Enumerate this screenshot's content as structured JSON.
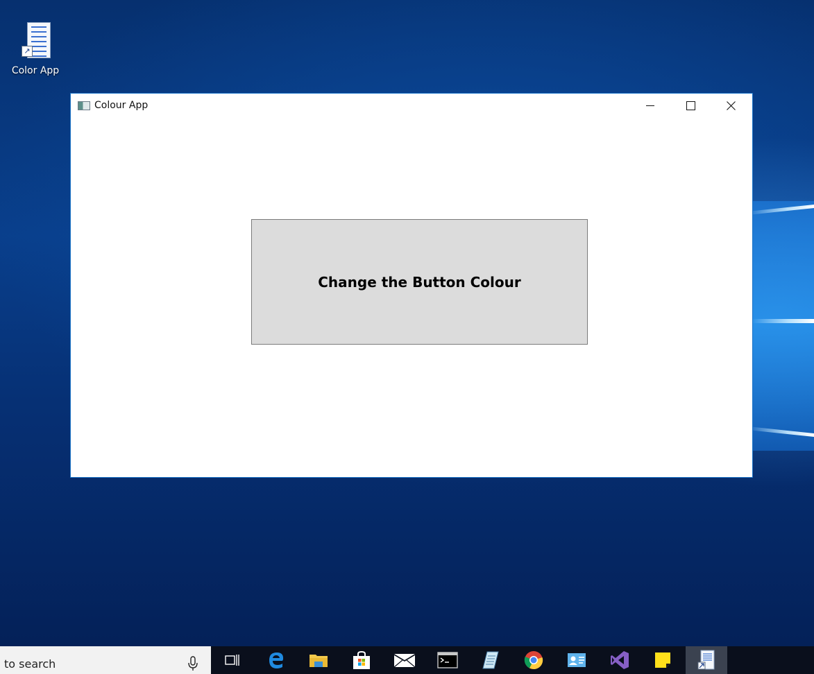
{
  "desktop": {
    "shortcut_label": "Color App"
  },
  "window": {
    "title": "Colour App",
    "button_label": "Change the Button Colour",
    "button_color": "#dcdcdc"
  },
  "taskbar": {
    "search_placeholder": "to search",
    "apps": [
      "task-view-icon",
      "edge-icon",
      "file-explorer-icon",
      "store-icon",
      "mail-icon",
      "terminal-icon",
      "notepad-icon",
      "chrome-icon",
      "contacts-icon",
      "visual-studio-icon",
      "sticky-notes-icon",
      "color-app-icon"
    ]
  }
}
